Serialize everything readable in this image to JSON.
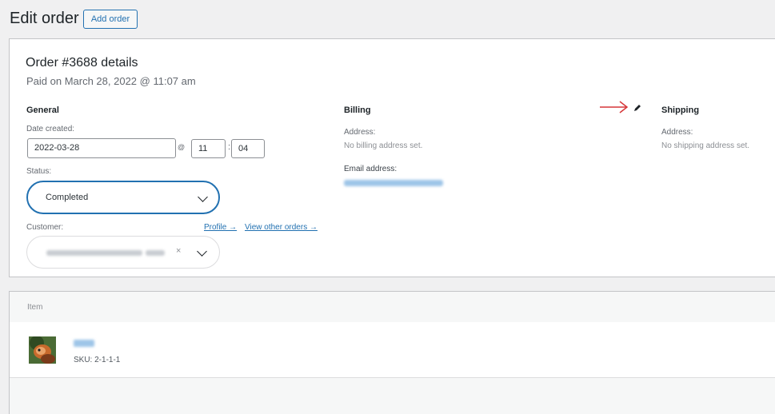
{
  "header": {
    "title": "Edit order",
    "add_button": "Add order"
  },
  "order": {
    "heading": "Order #3688 details",
    "paid_on": "Paid on March 28, 2022 @ 11:07 am"
  },
  "general": {
    "heading": "General",
    "date_label": "Date created:",
    "date_value": "2022-03-28",
    "at": "@",
    "hour": "11",
    "colon": ":",
    "minute": "04",
    "status_label": "Status:",
    "status_value": "Completed",
    "customer_label": "Customer:",
    "profile_link": "Profile →",
    "other_orders_link": "View other orders →",
    "customer_clear": "×"
  },
  "billing": {
    "heading": "Billing",
    "address_label": "Address:",
    "address_value": "No billing address set.",
    "email_label": "Email address:"
  },
  "shipping": {
    "heading": "Shipping",
    "address_label": "Address:",
    "address_value": "No shipping address set."
  },
  "items": {
    "column": "Item",
    "sku": "SKU: 2-1-1-1"
  },
  "colors": {
    "accent": "#2271b1",
    "arrow": "#d63638"
  }
}
